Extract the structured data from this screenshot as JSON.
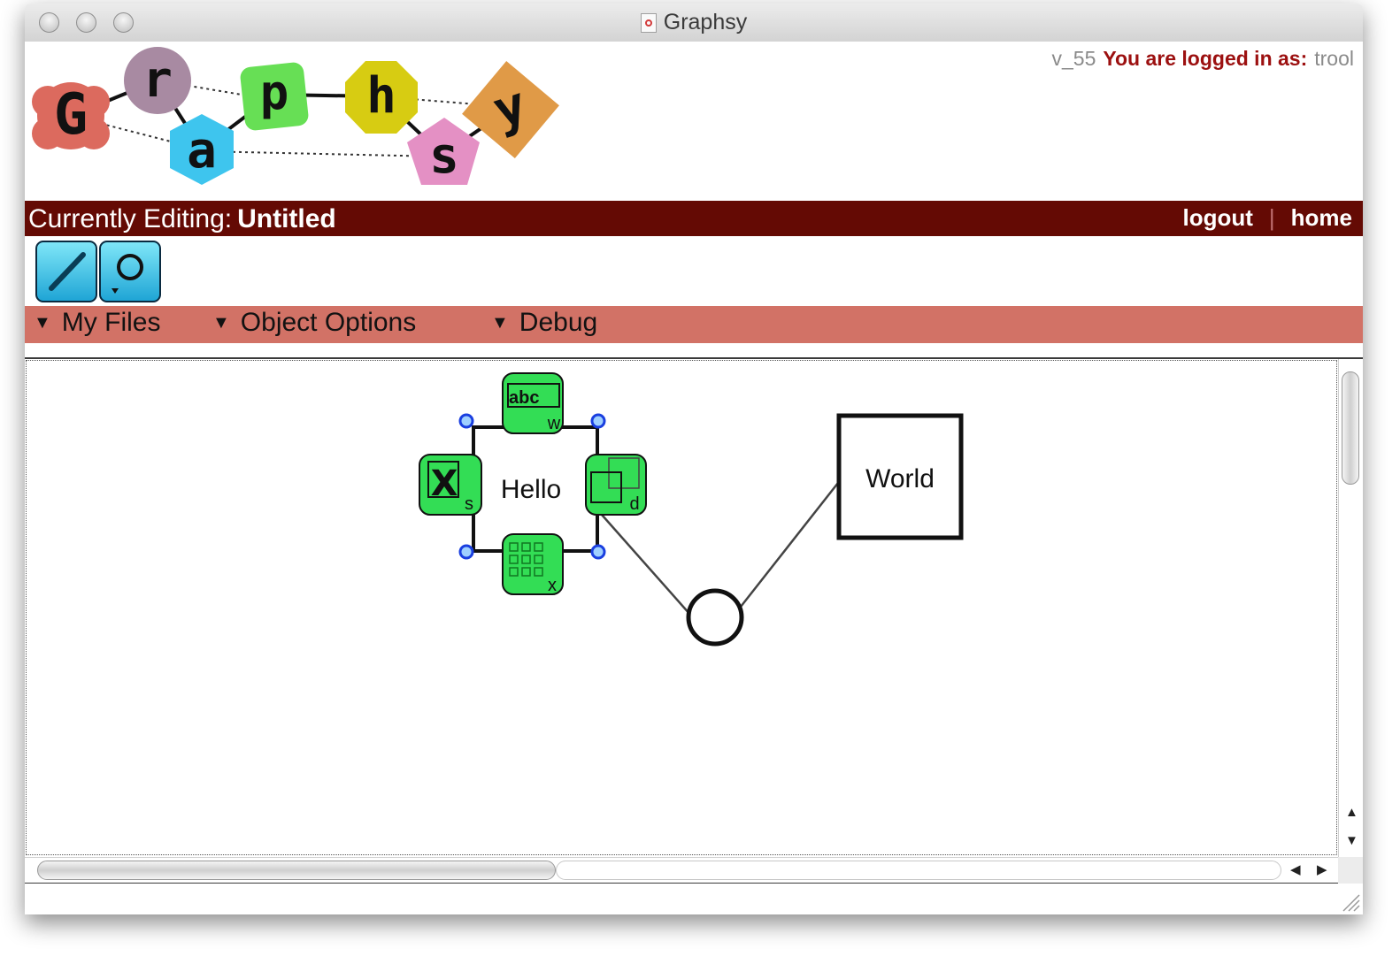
{
  "window": {
    "title": "Graphsy"
  },
  "logo": {
    "letters": [
      "G",
      "r",
      "a",
      "p",
      "h",
      "s",
      "y"
    ],
    "alt": "Graphsy"
  },
  "header": {
    "version": "v_55",
    "login_label": "You are logged in as:",
    "username": "trool"
  },
  "editbar": {
    "label": "Currently Editing:",
    "document_name": "Untitled",
    "nav": {
      "logout": "logout",
      "separator": "|",
      "home": "home"
    }
  },
  "tools": [
    {
      "name": "line-tool",
      "icon": "line-icon"
    },
    {
      "name": "circle-tool",
      "icon": "circle-icon"
    }
  ],
  "menus": [
    {
      "label": "My Files"
    },
    {
      "label": "Object Options"
    },
    {
      "label": "Debug"
    }
  ],
  "canvas": {
    "nodes": [
      {
        "id": "hello-node",
        "label": "Hello",
        "shape": "rectangle",
        "selected": true
      },
      {
        "id": "world-node",
        "label": "World",
        "shape": "square"
      },
      {
        "id": "circle-node",
        "label": "",
        "shape": "circle"
      }
    ],
    "handles": {
      "top": {
        "label": "abc",
        "key": "w"
      },
      "left": {
        "label": "X",
        "key": "s"
      },
      "right": {
        "key": "d"
      },
      "bottom": {
        "key": "x"
      }
    }
  },
  "colors": {
    "editbar": "#640a04",
    "menubar": "#d27266",
    "login_label": "#9c1010",
    "handle_green": "#33dd55",
    "tool_blue": "#1fa5d5"
  }
}
